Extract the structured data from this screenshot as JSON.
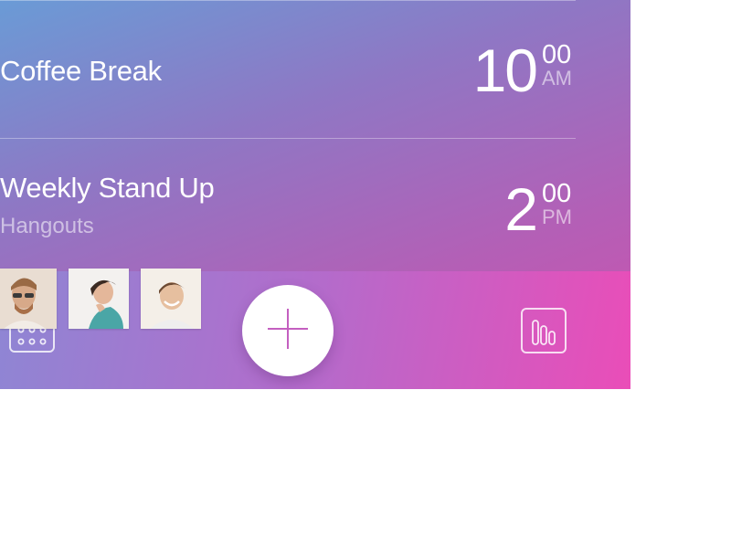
{
  "events": [
    {
      "title": "Coffee Break",
      "subtitle": "",
      "time": {
        "hour": "10",
        "minutes": "00",
        "period": "AM"
      }
    },
    {
      "title": "Weekly Stand Up",
      "subtitle": "Hangouts",
      "time": {
        "hour": "2",
        "minutes": "00",
        "period": "PM"
      }
    }
  ],
  "attendees": [
    {
      "name": "attendee-1",
      "icon": "avatar-man-sunglasses"
    },
    {
      "name": "attendee-2",
      "icon": "avatar-woman"
    },
    {
      "name": "attendee-3",
      "icon": "avatar-man-smiling"
    }
  ],
  "toolbar": {
    "calendar_icon": "calendar-icon",
    "add_icon": "plus-icon",
    "stats_icon": "bar-chart-icon"
  },
  "colors": {
    "gradient_start": "#6a9bd6",
    "gradient_end": "#d050ad",
    "bar_end": "#ea4db8",
    "accent": "#c84fb8"
  }
}
